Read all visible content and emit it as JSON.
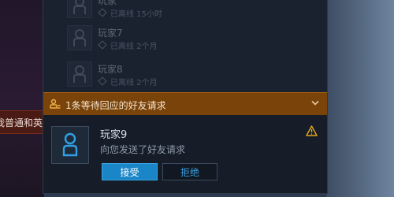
{
  "side_tip": {
    "text": "我普通和英"
  },
  "friends": [
    {
      "name": "玩家",
      "status": "已离线 15小时"
    },
    {
      "name": "玩家7",
      "status": "已离线 2个月"
    },
    {
      "name": "玩家8",
      "status": "已离线 2个月"
    }
  ],
  "request_bar": {
    "label": "1条等待回应的好友请求",
    "icon": "user-list-icon",
    "toggle_icon": "chevron-down-icon"
  },
  "request": {
    "name": "玩家9",
    "message": "向您发送了好友请求",
    "warning_icon": "warning-icon",
    "accept_label": "接受",
    "reject_label": "拒绝"
  },
  "colors": {
    "accent": "#1a86c8",
    "request_bar": "#7a4309",
    "warning": "#e6a817"
  }
}
